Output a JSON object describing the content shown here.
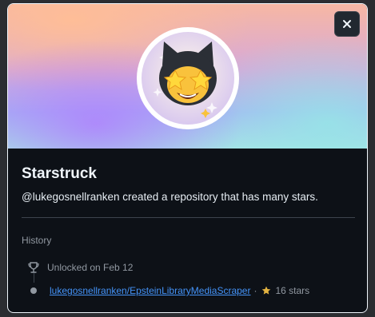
{
  "achievement": {
    "title": "Starstruck",
    "description": "@lukegosnellranken created a repository that has many stars.",
    "badge_icon": "starstruck-octocat-badge"
  },
  "close_icon": "close-icon",
  "history": {
    "label": "History",
    "unlocked_text": "Unlocked on Feb 12",
    "repo_name": "lukegosnellranken/EpsteinLibraryMediaScraper",
    "separator": "·",
    "stars_text": "16 stars"
  },
  "colors": {
    "background": "#0d1117",
    "border": "#f0f6fc",
    "link": "#4493f8",
    "muted": "#9198a1",
    "star": "#e3b341"
  }
}
